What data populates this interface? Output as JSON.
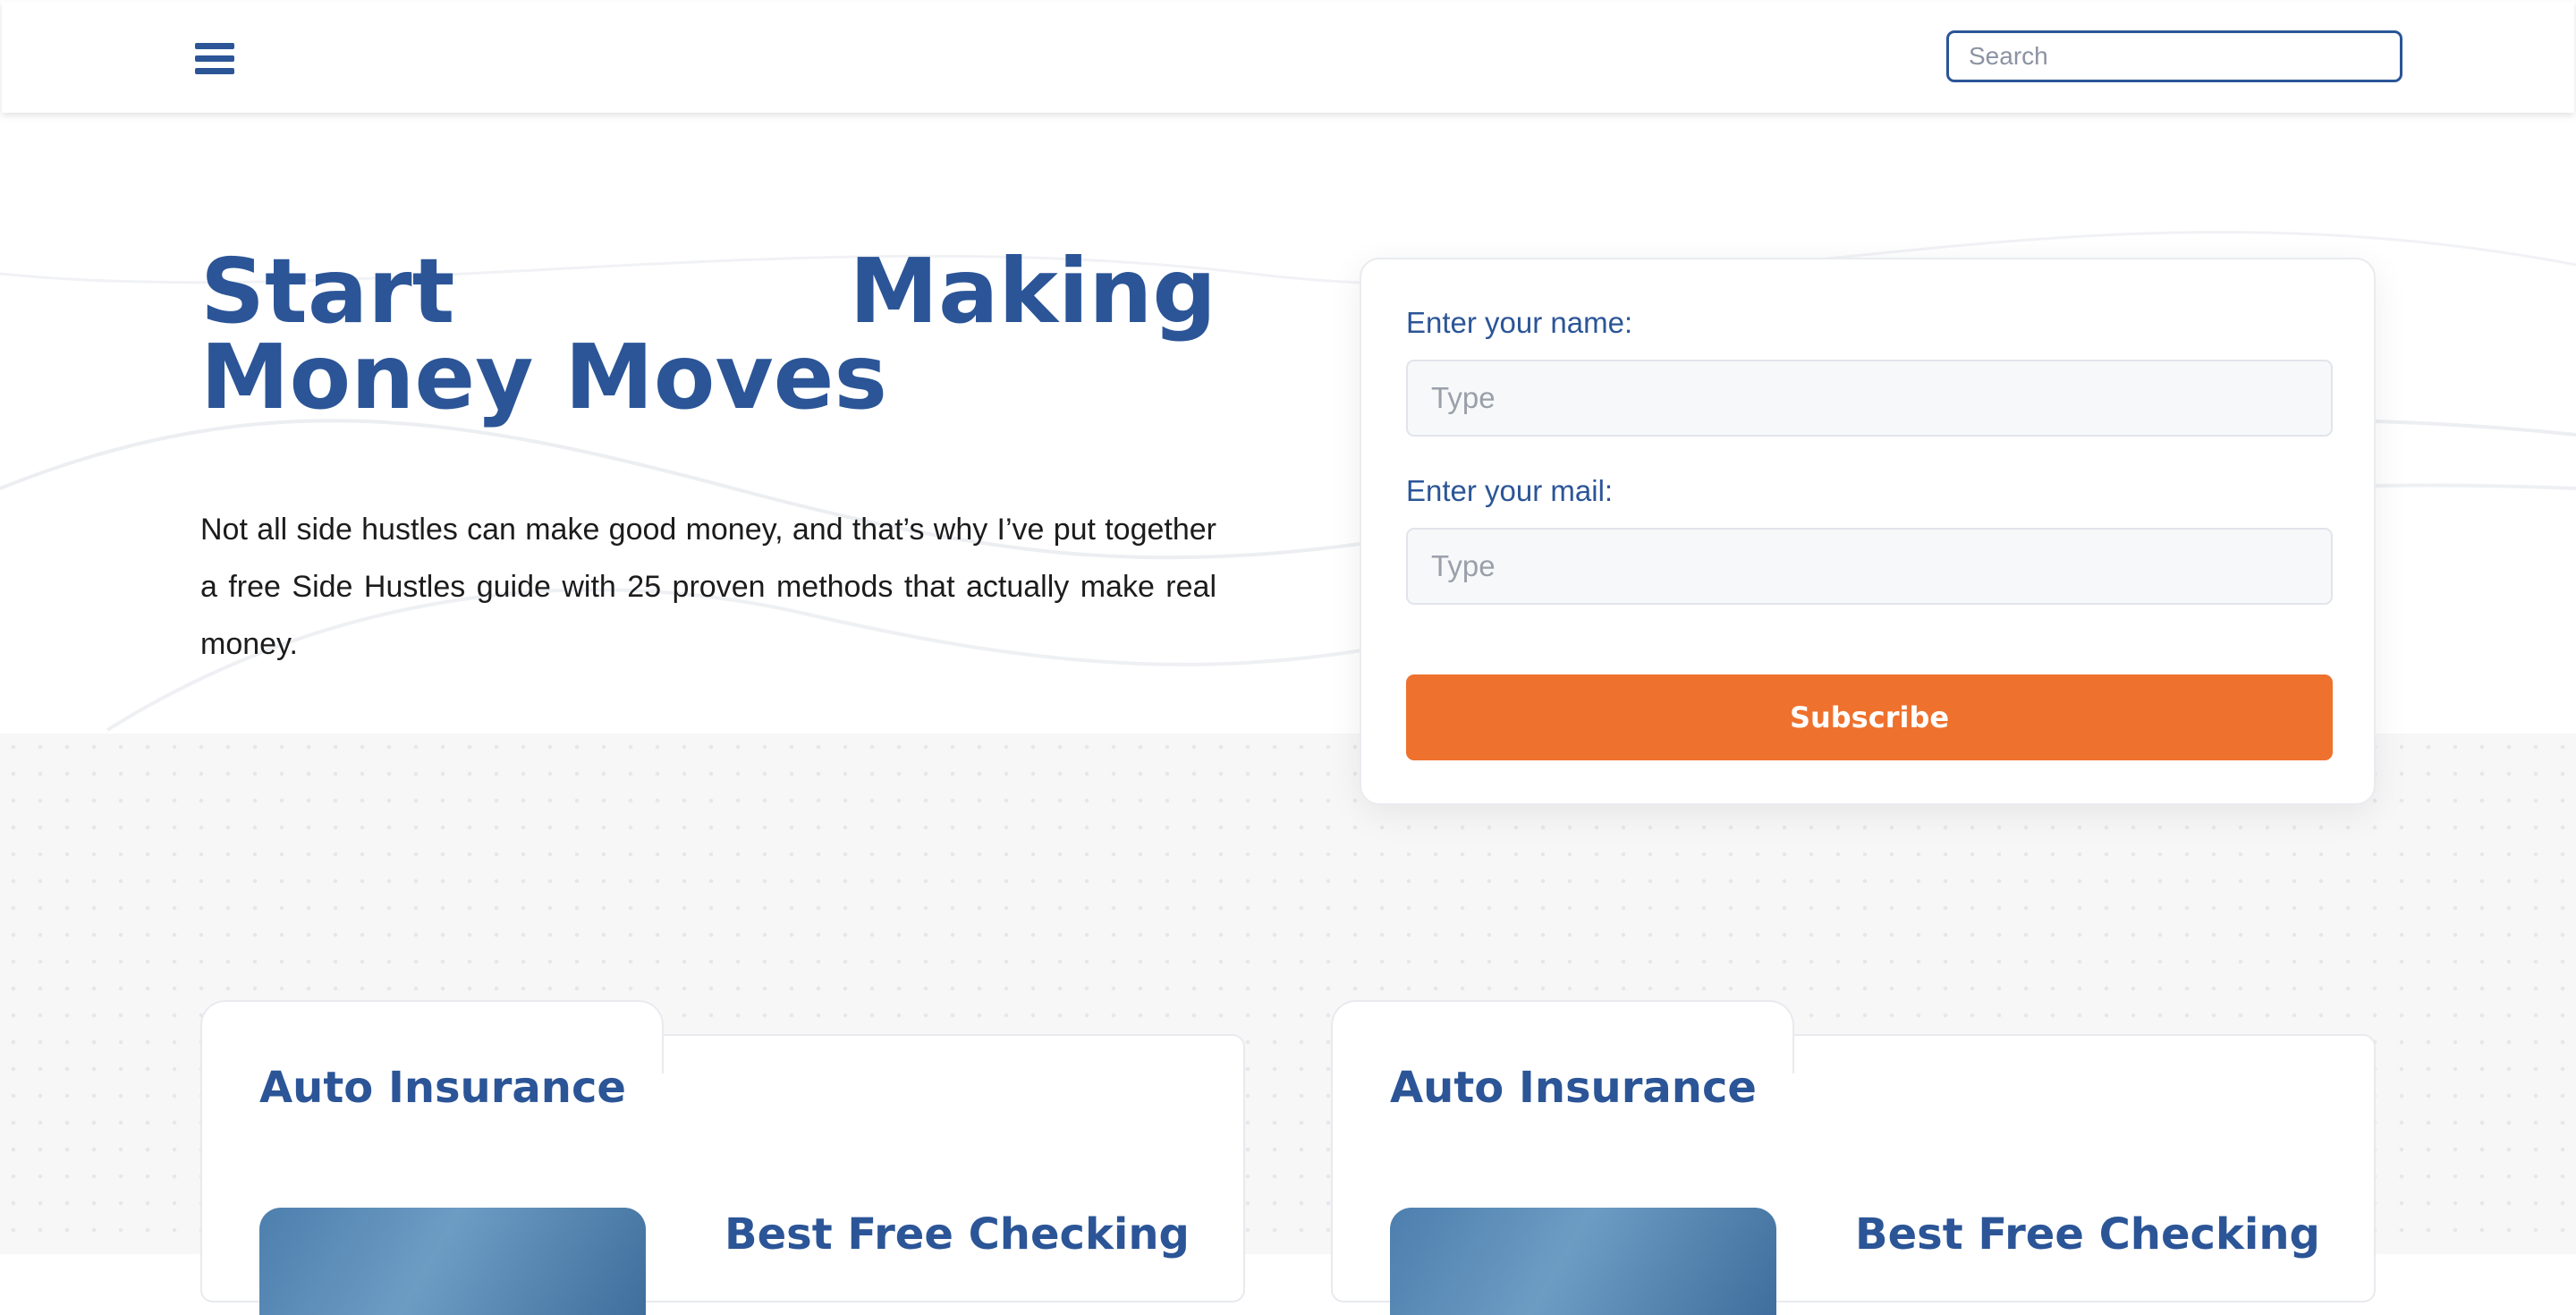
{
  "header": {
    "search": {
      "placeholder": "Search",
      "value": ""
    },
    "menu_icon": "hamburger-menu-icon"
  },
  "hero": {
    "title": "Start Making Money Moves",
    "description": "Not all side hustles can make good money, and that’s why I’ve put together a free Side Hustles guide with 25 proven methods that actually make real money."
  },
  "form": {
    "name_label": "Enter your name:",
    "name_placeholder": "Type",
    "mail_label": "Enter your mail:",
    "mail_placeholder": "Type",
    "submit_label": "Subscribe"
  },
  "cards": [
    {
      "heading": "Auto Insurance",
      "subheading": "Best Free Checking"
    },
    {
      "heading": "Auto Insurance",
      "subheading": "Best Free Checking"
    }
  ],
  "colors": {
    "primary": "#2b5597",
    "accent": "#ee712e",
    "text": "#1c1c1c",
    "section_bg": "#f7f7f8"
  }
}
